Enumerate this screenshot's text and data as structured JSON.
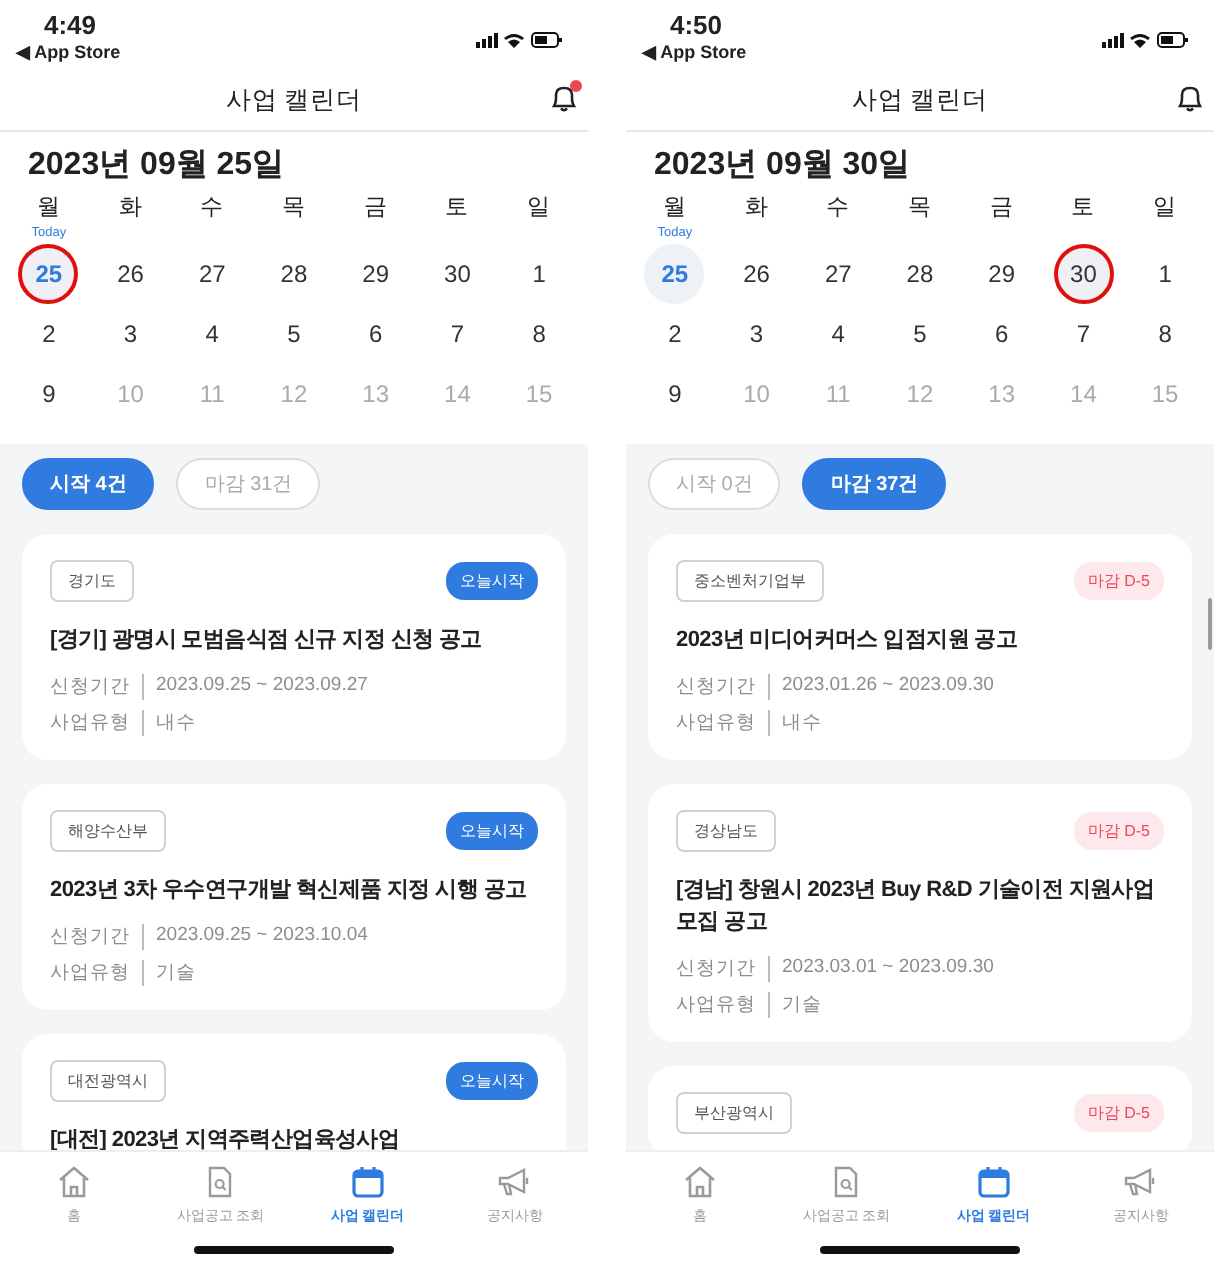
{
  "panels": [
    {
      "status": {
        "time": "4:49",
        "back": "◀ App Store"
      },
      "header": {
        "title": "사업 캘린더",
        "bell_badge": true
      },
      "date_heading": "2023년 09월 25일",
      "weekdays": [
        "월",
        "화",
        "수",
        "목",
        "금",
        "토",
        "일"
      ],
      "today_label": "Today",
      "weeks": [
        [
          {
            "day": "25",
            "today": true,
            "selected": true,
            "muted": false
          },
          {
            "day": "26",
            "today": false,
            "selected": false,
            "muted": false
          },
          {
            "day": "27",
            "today": false,
            "selected": false,
            "muted": false
          },
          {
            "day": "28",
            "today": false,
            "selected": false,
            "muted": false
          },
          {
            "day": "29",
            "today": false,
            "selected": false,
            "muted": false
          },
          {
            "day": "30",
            "today": false,
            "selected": false,
            "muted": false
          },
          {
            "day": "1",
            "today": false,
            "selected": false,
            "muted": false
          }
        ],
        [
          {
            "day": "2",
            "today": false,
            "selected": false,
            "muted": false
          },
          {
            "day": "3",
            "today": false,
            "selected": false,
            "muted": false
          },
          {
            "day": "4",
            "today": false,
            "selected": false,
            "muted": false
          },
          {
            "day": "5",
            "today": false,
            "selected": false,
            "muted": false
          },
          {
            "day": "6",
            "today": false,
            "selected": false,
            "muted": false
          },
          {
            "day": "7",
            "today": false,
            "selected": false,
            "muted": false
          },
          {
            "day": "8",
            "today": false,
            "selected": false,
            "muted": false
          }
        ],
        [
          {
            "day": "9",
            "today": false,
            "selected": false,
            "muted": false
          },
          {
            "day": "10",
            "today": false,
            "selected": false,
            "muted": true
          },
          {
            "day": "11",
            "today": false,
            "selected": false,
            "muted": true
          },
          {
            "day": "12",
            "today": false,
            "selected": false,
            "muted": true
          },
          {
            "day": "13",
            "today": false,
            "selected": false,
            "muted": true
          },
          {
            "day": "14",
            "today": false,
            "selected": false,
            "muted": true
          },
          {
            "day": "15",
            "today": false,
            "selected": false,
            "muted": true
          }
        ]
      ],
      "filters": [
        {
          "label": "시작 4건",
          "selected": true
        },
        {
          "label": "마감 31건",
          "selected": false
        }
      ],
      "cards": [
        {
          "tag": "경기도",
          "badge": {
            "label": "오늘시작",
            "kind": "start"
          },
          "title": "[경기] 광명시 모범음식점 신규 지정 신청 공고",
          "meta": [
            {
              "label": "신청기간",
              "value": "2023.09.25 ~ 2023.09.27"
            },
            {
              "label": "사업유형",
              "value": "내수"
            }
          ]
        },
        {
          "tag": "해양수산부",
          "badge": {
            "label": "오늘시작",
            "kind": "start"
          },
          "title": "2023년 3차 우수연구개발 혁신제품 지정 시행 공고",
          "meta": [
            {
              "label": "신청기간",
              "value": "2023.09.25 ~ 2023.10.04"
            },
            {
              "label": "사업유형",
              "value": "기술"
            }
          ]
        },
        {
          "tag": "대전광역시",
          "badge": {
            "label": "오늘시작",
            "kind": "start"
          },
          "title": "[대전] 2023년 지역주력산업육성사업"
        }
      ],
      "tabs": [
        {
          "label": "홈",
          "selected": false
        },
        {
          "label": "사업공고 조회",
          "selected": false
        },
        {
          "label": "사업 캘린더",
          "selected": true
        },
        {
          "label": "공지사항",
          "selected": false
        }
      ]
    },
    {
      "status": {
        "time": "4:50",
        "back": "◀ App Store"
      },
      "header": {
        "title": "사업 캘린더",
        "bell_badge": false
      },
      "date_heading": "2023년 09월 30일",
      "weekdays": [
        "월",
        "화",
        "수",
        "목",
        "금",
        "토",
        "일"
      ],
      "today_label": "Today",
      "weeks": [
        [
          {
            "day": "25",
            "today": true,
            "selected": false,
            "muted": false
          },
          {
            "day": "26",
            "today": false,
            "selected": false,
            "muted": false
          },
          {
            "day": "27",
            "today": false,
            "selected": false,
            "muted": false
          },
          {
            "day": "28",
            "today": false,
            "selected": false,
            "muted": false
          },
          {
            "day": "29",
            "today": false,
            "selected": false,
            "muted": false
          },
          {
            "day": "30",
            "today": false,
            "selected": true,
            "muted": false
          },
          {
            "day": "1",
            "today": false,
            "selected": false,
            "muted": false
          }
        ],
        [
          {
            "day": "2",
            "today": false,
            "selected": false,
            "muted": false
          },
          {
            "day": "3",
            "today": false,
            "selected": false,
            "muted": false
          },
          {
            "day": "4",
            "today": false,
            "selected": false,
            "muted": false
          },
          {
            "day": "5",
            "today": false,
            "selected": false,
            "muted": false
          },
          {
            "day": "6",
            "today": false,
            "selected": false,
            "muted": false
          },
          {
            "day": "7",
            "today": false,
            "selected": false,
            "muted": false
          },
          {
            "day": "8",
            "today": false,
            "selected": false,
            "muted": false
          }
        ],
        [
          {
            "day": "9",
            "today": false,
            "selected": false,
            "muted": false
          },
          {
            "day": "10",
            "today": false,
            "selected": false,
            "muted": true
          },
          {
            "day": "11",
            "today": false,
            "selected": false,
            "muted": true
          },
          {
            "day": "12",
            "today": false,
            "selected": false,
            "muted": true
          },
          {
            "day": "13",
            "today": false,
            "selected": false,
            "muted": true
          },
          {
            "day": "14",
            "today": false,
            "selected": false,
            "muted": true
          },
          {
            "day": "15",
            "today": false,
            "selected": false,
            "muted": true
          }
        ]
      ],
      "filters": [
        {
          "label": "시작 0건",
          "selected": false
        },
        {
          "label": "마감 37건",
          "selected": true
        }
      ],
      "cards": [
        {
          "tag": "중소벤처기업부",
          "badge": {
            "label": "마감 D-5",
            "kind": "deadline"
          },
          "title": "2023년 미디어커머스 입점지원 공고",
          "meta": [
            {
              "label": "신청기간",
              "value": "2023.01.26 ~ 2023.09.30"
            },
            {
              "label": "사업유형",
              "value": "내수"
            }
          ]
        },
        {
          "tag": "경상남도",
          "badge": {
            "label": "마감 D-5",
            "kind": "deadline"
          },
          "title": "[경남] 창원시 2023년 Buy R&D 기술이전 지원사업 모집 공고",
          "meta": [
            {
              "label": "신청기간",
              "value": "2023.03.01 ~ 2023.09.30"
            },
            {
              "label": "사업유형",
              "value": "기술"
            }
          ]
        },
        {
          "tag": "부산광역시",
          "badge": {
            "label": "마감 D-5",
            "kind": "deadline"
          }
        }
      ],
      "tabs": [
        {
          "label": "홈",
          "selected": false
        },
        {
          "label": "사업공고 조회",
          "selected": false
        },
        {
          "label": "사업 캘린더",
          "selected": true
        },
        {
          "label": "공지사항",
          "selected": false
        }
      ]
    }
  ]
}
